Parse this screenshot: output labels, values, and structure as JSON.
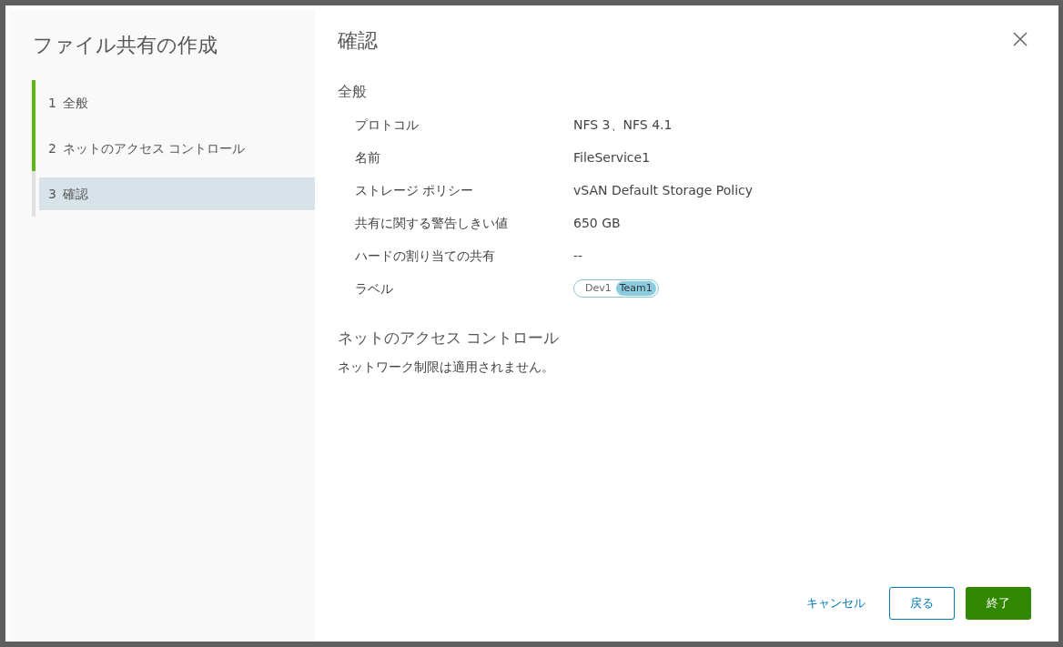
{
  "dialog": {
    "title": "ファイル共有の作成"
  },
  "steps": [
    {
      "number": "1",
      "label": "全般",
      "completed": true,
      "selected": false
    },
    {
      "number": "2",
      "label": "ネットのアクセス コントロール",
      "completed": true,
      "selected": false
    },
    {
      "number": "3",
      "label": "確認",
      "completed": false,
      "selected": true
    }
  ],
  "page": {
    "title": "確認"
  },
  "general": {
    "heading": "全般",
    "rows": [
      {
        "kind": "text",
        "label": "プロトコル",
        "value": "NFS 3、NFS 4.1"
      },
      {
        "kind": "text",
        "label": "名前",
        "value": "FileService1"
      },
      {
        "kind": "text",
        "label": "ストレージ ポリシー",
        "value": "vSAN Default Storage Policy"
      },
      {
        "kind": "text",
        "label": "共有に関する警告しきい値",
        "value": "650 GB"
      },
      {
        "kind": "text",
        "label": "ハードの割り当ての共有",
        "value": "--"
      },
      {
        "kind": "tag",
        "label": "ラベル",
        "tag": {
          "category": "Dev1",
          "value": "Team1"
        }
      }
    ]
  },
  "network": {
    "heading": "ネットのアクセス コントロール",
    "text": "ネットワーク制限は適用されません。"
  },
  "buttons": [
    {
      "kind": "link",
      "label": "キャンセル"
    },
    {
      "kind": "outline",
      "label": "戻る"
    },
    {
      "kind": "primary",
      "label": "終了"
    }
  ]
}
